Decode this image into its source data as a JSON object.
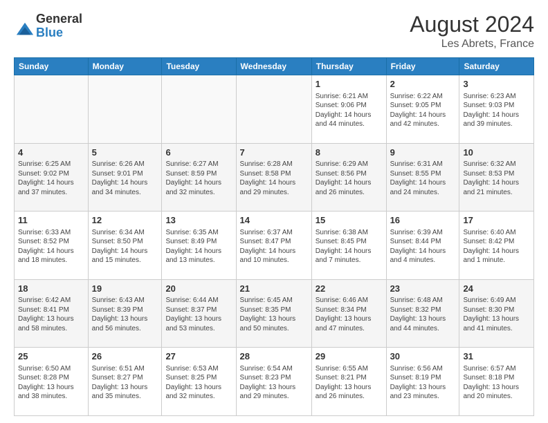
{
  "logo": {
    "general": "General",
    "blue": "Blue"
  },
  "header": {
    "title": "August 2024",
    "subtitle": "Les Abrets, France"
  },
  "weekdays": [
    "Sunday",
    "Monday",
    "Tuesday",
    "Wednesday",
    "Thursday",
    "Friday",
    "Saturday"
  ],
  "weeks": [
    [
      {
        "day": "",
        "info": ""
      },
      {
        "day": "",
        "info": ""
      },
      {
        "day": "",
        "info": ""
      },
      {
        "day": "",
        "info": ""
      },
      {
        "day": "1",
        "info": "Sunrise: 6:21 AM\nSunset: 9:06 PM\nDaylight: 14 hours and 44 minutes."
      },
      {
        "day": "2",
        "info": "Sunrise: 6:22 AM\nSunset: 9:05 PM\nDaylight: 14 hours and 42 minutes."
      },
      {
        "day": "3",
        "info": "Sunrise: 6:23 AM\nSunset: 9:03 PM\nDaylight: 14 hours and 39 minutes."
      }
    ],
    [
      {
        "day": "4",
        "info": "Sunrise: 6:25 AM\nSunset: 9:02 PM\nDaylight: 14 hours and 37 minutes."
      },
      {
        "day": "5",
        "info": "Sunrise: 6:26 AM\nSunset: 9:01 PM\nDaylight: 14 hours and 34 minutes."
      },
      {
        "day": "6",
        "info": "Sunrise: 6:27 AM\nSunset: 8:59 PM\nDaylight: 14 hours and 32 minutes."
      },
      {
        "day": "7",
        "info": "Sunrise: 6:28 AM\nSunset: 8:58 PM\nDaylight: 14 hours and 29 minutes."
      },
      {
        "day": "8",
        "info": "Sunrise: 6:29 AM\nSunset: 8:56 PM\nDaylight: 14 hours and 26 minutes."
      },
      {
        "day": "9",
        "info": "Sunrise: 6:31 AM\nSunset: 8:55 PM\nDaylight: 14 hours and 24 minutes."
      },
      {
        "day": "10",
        "info": "Sunrise: 6:32 AM\nSunset: 8:53 PM\nDaylight: 14 hours and 21 minutes."
      }
    ],
    [
      {
        "day": "11",
        "info": "Sunrise: 6:33 AM\nSunset: 8:52 PM\nDaylight: 14 hours and 18 minutes."
      },
      {
        "day": "12",
        "info": "Sunrise: 6:34 AM\nSunset: 8:50 PM\nDaylight: 14 hours and 15 minutes."
      },
      {
        "day": "13",
        "info": "Sunrise: 6:35 AM\nSunset: 8:49 PM\nDaylight: 14 hours and 13 minutes."
      },
      {
        "day": "14",
        "info": "Sunrise: 6:37 AM\nSunset: 8:47 PM\nDaylight: 14 hours and 10 minutes."
      },
      {
        "day": "15",
        "info": "Sunrise: 6:38 AM\nSunset: 8:45 PM\nDaylight: 14 hours and 7 minutes."
      },
      {
        "day": "16",
        "info": "Sunrise: 6:39 AM\nSunset: 8:44 PM\nDaylight: 14 hours and 4 minutes."
      },
      {
        "day": "17",
        "info": "Sunrise: 6:40 AM\nSunset: 8:42 PM\nDaylight: 14 hours and 1 minute."
      }
    ],
    [
      {
        "day": "18",
        "info": "Sunrise: 6:42 AM\nSunset: 8:41 PM\nDaylight: 13 hours and 58 minutes."
      },
      {
        "day": "19",
        "info": "Sunrise: 6:43 AM\nSunset: 8:39 PM\nDaylight: 13 hours and 56 minutes."
      },
      {
        "day": "20",
        "info": "Sunrise: 6:44 AM\nSunset: 8:37 PM\nDaylight: 13 hours and 53 minutes."
      },
      {
        "day": "21",
        "info": "Sunrise: 6:45 AM\nSunset: 8:35 PM\nDaylight: 13 hours and 50 minutes."
      },
      {
        "day": "22",
        "info": "Sunrise: 6:46 AM\nSunset: 8:34 PM\nDaylight: 13 hours and 47 minutes."
      },
      {
        "day": "23",
        "info": "Sunrise: 6:48 AM\nSunset: 8:32 PM\nDaylight: 13 hours and 44 minutes."
      },
      {
        "day": "24",
        "info": "Sunrise: 6:49 AM\nSunset: 8:30 PM\nDaylight: 13 hours and 41 minutes."
      }
    ],
    [
      {
        "day": "25",
        "info": "Sunrise: 6:50 AM\nSunset: 8:28 PM\nDaylight: 13 hours and 38 minutes."
      },
      {
        "day": "26",
        "info": "Sunrise: 6:51 AM\nSunset: 8:27 PM\nDaylight: 13 hours and 35 minutes."
      },
      {
        "day": "27",
        "info": "Sunrise: 6:53 AM\nSunset: 8:25 PM\nDaylight: 13 hours and 32 minutes."
      },
      {
        "day": "28",
        "info": "Sunrise: 6:54 AM\nSunset: 8:23 PM\nDaylight: 13 hours and 29 minutes."
      },
      {
        "day": "29",
        "info": "Sunrise: 6:55 AM\nSunset: 8:21 PM\nDaylight: 13 hours and 26 minutes."
      },
      {
        "day": "30",
        "info": "Sunrise: 6:56 AM\nSunset: 8:19 PM\nDaylight: 13 hours and 23 minutes."
      },
      {
        "day": "31",
        "info": "Sunrise: 6:57 AM\nSunset: 8:18 PM\nDaylight: 13 hours and 20 minutes."
      }
    ]
  ]
}
